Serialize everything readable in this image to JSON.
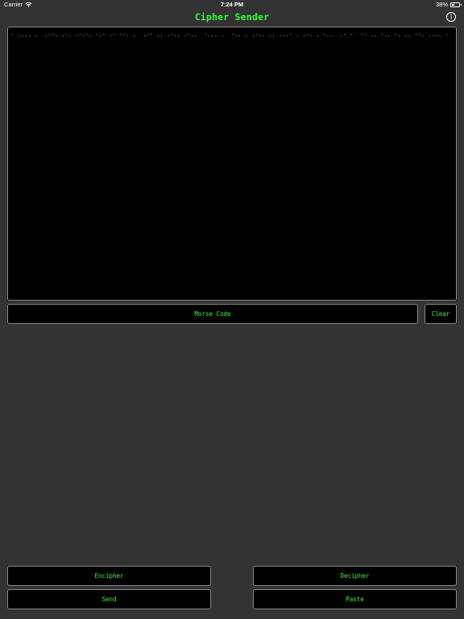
{
  "status_bar": {
    "carrier": "Carrier",
    "time": "7:24 PM",
    "battery_percent": "38%",
    "battery_level": 0.38,
    "icons": [
      "wifi-icon",
      "battery-icon"
    ]
  },
  "nav": {
    "title": "Cipher Sender",
    "info_icon": "info-icon",
    "info_glyph": "i"
  },
  "message": {
    "text": "- .... .  .--. .-. .-.-. -.- .- --. .  .-- .. .-.. .-..  -... .  -.. . .-.. .. ...- . .-. . -..  .- -  -- .. -.. -. .. --. .... -"
  },
  "controls": {
    "mode_label": "Morse Code",
    "clear_label": "Clear"
  },
  "actions": {
    "encipher_label": "Encipher",
    "decipher_label": "Decipher",
    "send_label": "Send",
    "paste_label": "Paste"
  },
  "colors": {
    "background": "#333333",
    "accent_green": "#33ff33",
    "field_background": "#000000",
    "border": "#888888"
  }
}
